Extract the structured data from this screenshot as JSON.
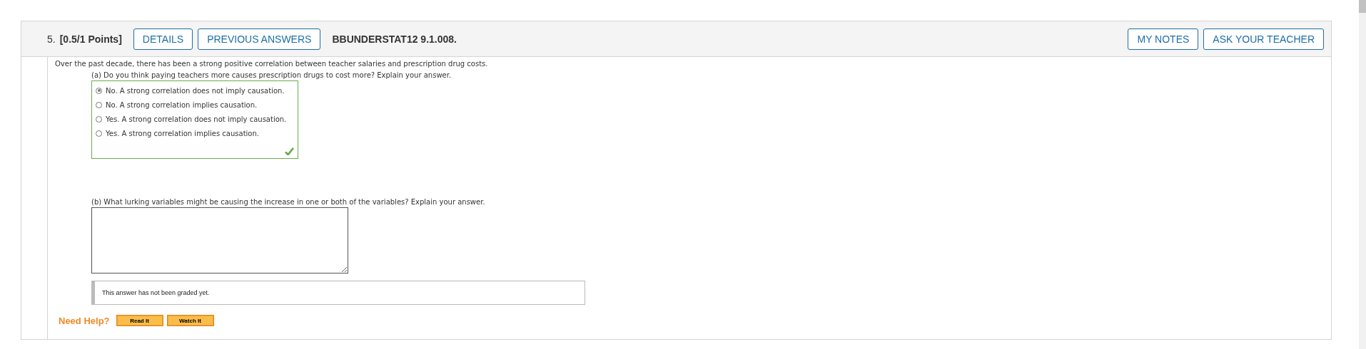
{
  "header": {
    "number": "5.",
    "points": "[0.5/1 Points]",
    "buttons_left": [
      "DETAILS",
      "PREVIOUS ANSWERS"
    ],
    "code": "BBUNDERSTAT12 9.1.008.",
    "buttons_right": [
      "MY NOTES",
      "ASK YOUR TEACHER"
    ]
  },
  "intro": "Over the past decade, there has been a strong positive correlation between teacher salaries and prescription drug costs.",
  "part_a": {
    "question": "(a) Do you think paying teachers more causes prescription drugs to cost more? Explain your answer.",
    "correct": true,
    "options": [
      {
        "label": "No. A strong correlation does not imply causation.",
        "selected": true
      },
      {
        "label": "No. A strong correlation implies causation.",
        "selected": false
      },
      {
        "label": "Yes. A strong correlation does not imply causation.",
        "selected": false
      },
      {
        "label": "Yes. A strong correlation implies causation.",
        "selected": false
      }
    ]
  },
  "part_b": {
    "question": "(b) What lurking variables might be causing the increase in one or both of the variables? Explain your answer.",
    "grading_note": "This answer has not been graded yet."
  },
  "help": {
    "label": "Need Help?",
    "buttons": [
      "Read It",
      "Watch It"
    ]
  }
}
